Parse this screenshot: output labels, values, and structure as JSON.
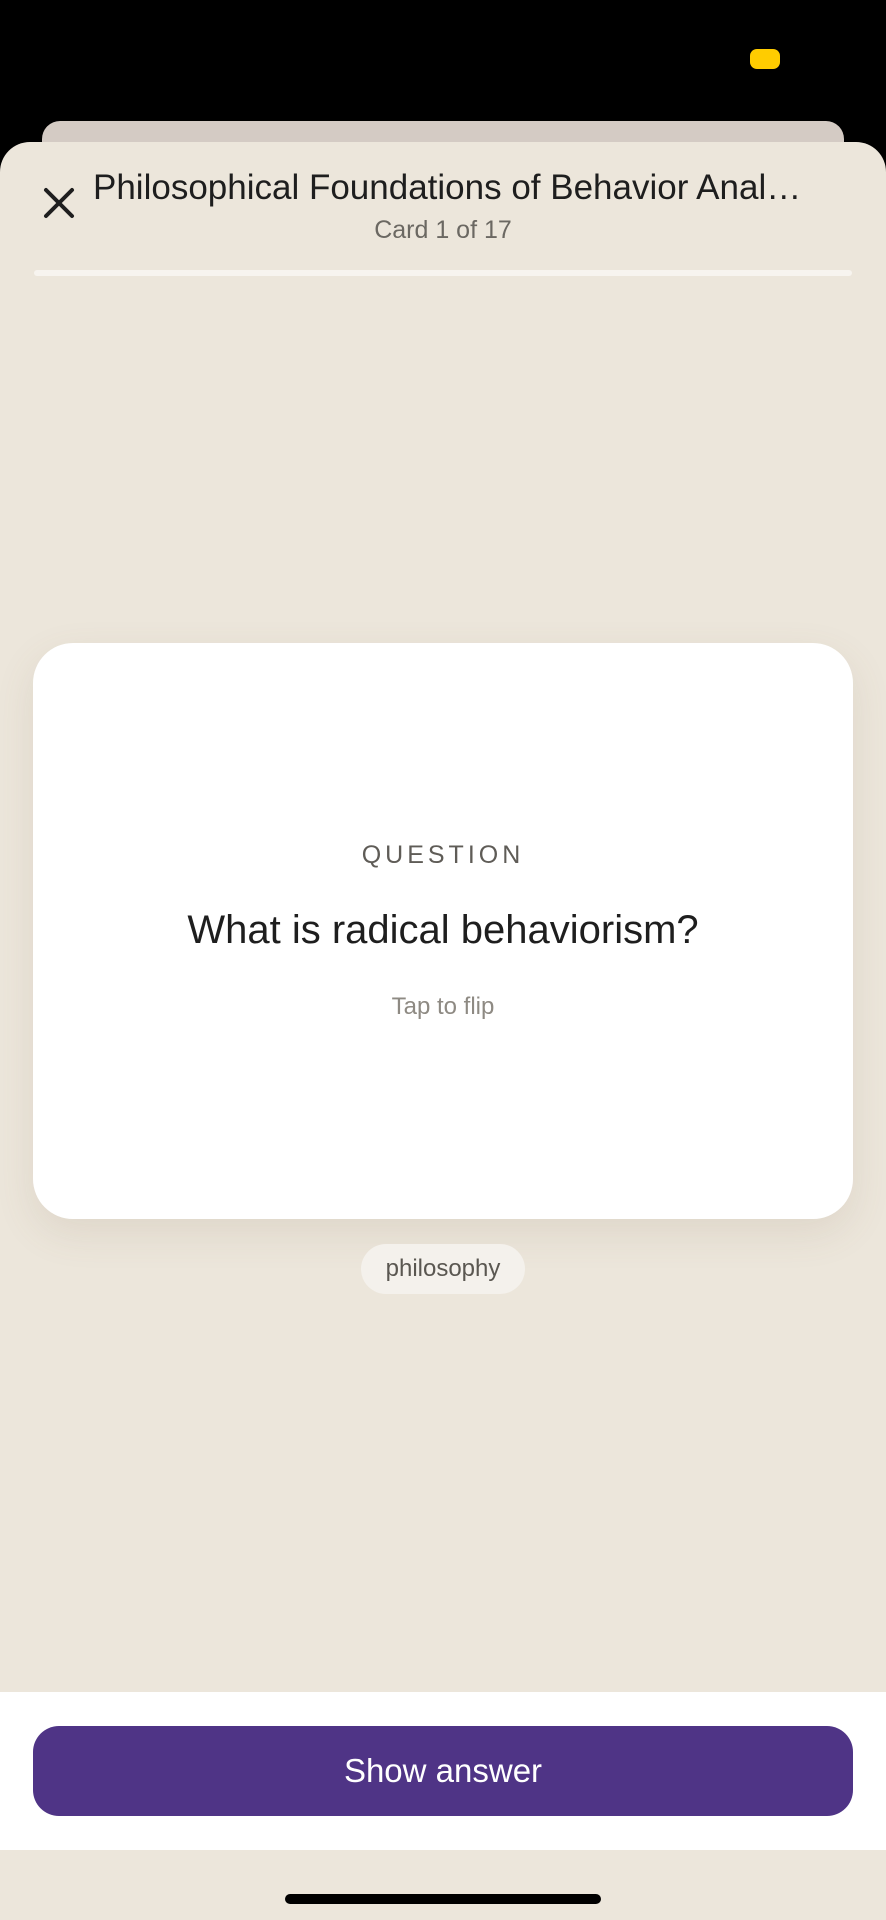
{
  "header": {
    "title": "Philosophical Foundations of Behavior Anal…",
    "counter": "Card 1 of 17"
  },
  "progress": {
    "current": 1,
    "total": 17,
    "fraction": 0,
    "fill_color": "#4F3486",
    "track_color": "#F7F4EF"
  },
  "card": {
    "label": "QUESTION",
    "question": "What is radical behaviorism?",
    "hint": "Tap to flip"
  },
  "tags": [
    "philosophy"
  ],
  "actions": {
    "show_answer_label": "Show answer"
  },
  "icons": {
    "close": "close-icon"
  },
  "colors": {
    "background": "#ECE6DB",
    "card": "#FFFFFF",
    "accent": "#4F3486",
    "status_indicator": "#FFCC00",
    "text_primary": "#1E1E1E",
    "text_secondary": "#6B6862"
  }
}
